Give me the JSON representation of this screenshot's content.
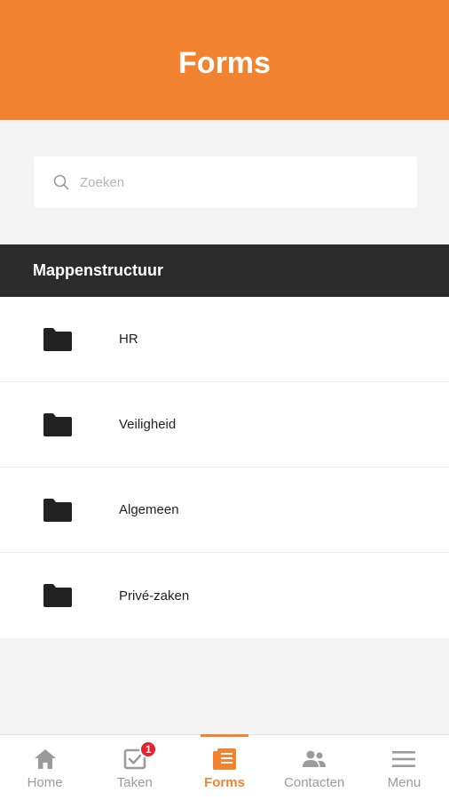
{
  "header": {
    "title": "Forms"
  },
  "search": {
    "placeholder": "Zoeken",
    "value": ""
  },
  "section": {
    "title": "Mappenstructuur"
  },
  "folders": [
    {
      "label": "HR",
      "icon": "folder-icon"
    },
    {
      "label": "Veiligheid",
      "icon": "folder-icon"
    },
    {
      "label": "Algemeen",
      "icon": "folder-icon"
    },
    {
      "label": "Privé-zaken",
      "icon": "folder-icon"
    }
  ],
  "tabbar": {
    "tabs": [
      {
        "label": "Home",
        "icon": "home-icon",
        "active": false
      },
      {
        "label": "Taken",
        "icon": "tasks-icon",
        "active": false,
        "badge": "1"
      },
      {
        "label": "Forms",
        "icon": "forms-icon",
        "active": true
      },
      {
        "label": "Contacten",
        "icon": "contacts-icon",
        "active": false
      },
      {
        "label": "Menu",
        "icon": "menu-icon",
        "active": false
      }
    ]
  },
  "colors": {
    "accent": "#f28431",
    "header_bg": "#f28431",
    "section_bg": "#2b2b2b",
    "badge": "#e8202a",
    "inactive": "#9b9b9b"
  }
}
